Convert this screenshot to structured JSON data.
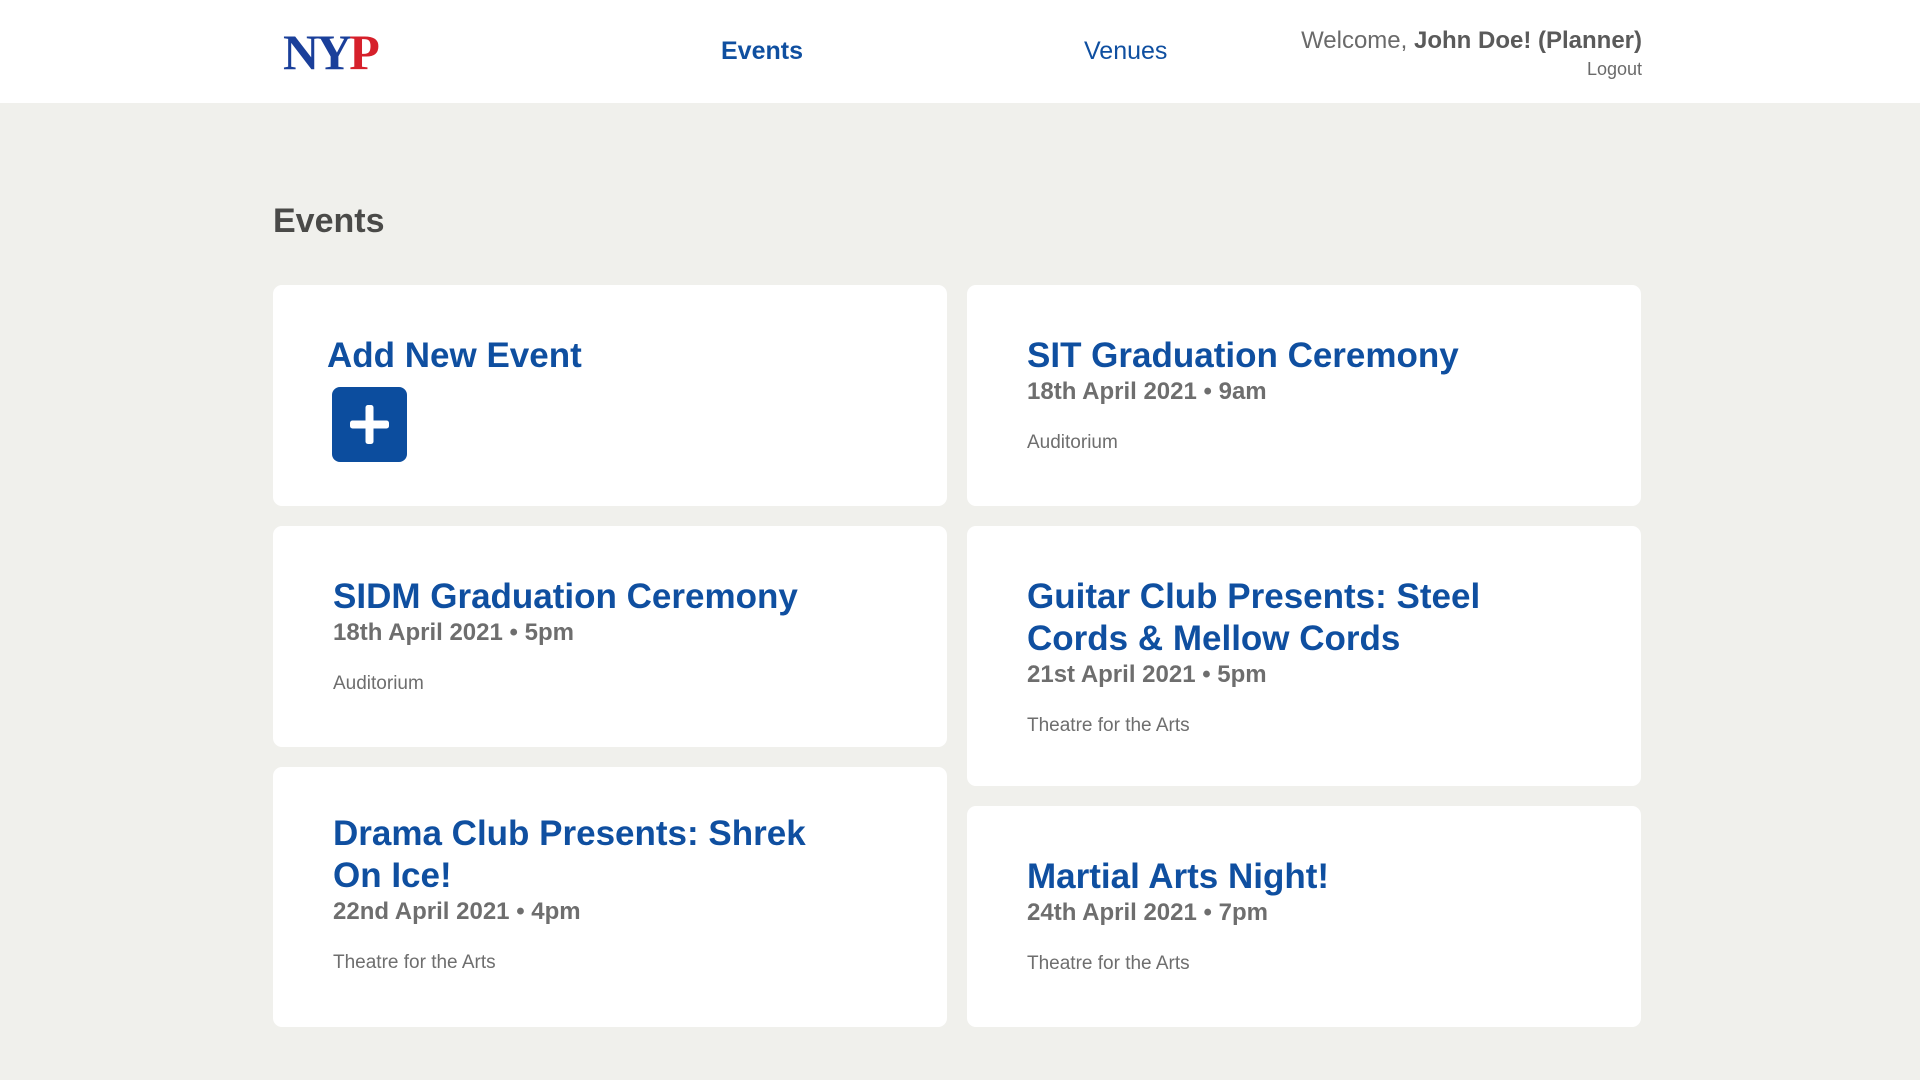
{
  "header": {
    "logo_ny": "NY",
    "logo_p": "P",
    "nav": [
      {
        "label": "Events"
      },
      {
        "label": "Venues"
      }
    ],
    "welcome_prefix": "Welcome, ",
    "user_name": "John Doe! (Planner)",
    "logout_label": "Logout"
  },
  "main": {
    "title": "Events",
    "add_card": {
      "label": "Add New Event"
    },
    "events": [
      {
        "title": "SIT Graduation Ceremony",
        "when": "18th April 2021 • 9am",
        "venue": "Auditorium"
      },
      {
        "title": "SIDM Graduation Ceremony",
        "when": "18th April 2021 • 5pm",
        "venue": "Auditorium"
      },
      {
        "title": "Guitar Club Presents: Steel Cords & Mellow Cords",
        "when": "21st April 2021 • 5pm",
        "venue": "Theatre for the Arts"
      },
      {
        "title": "Drama Club Presents: Shrek On Ice!",
        "when": "22nd April 2021 • 4pm",
        "venue": "Theatre for the Arts"
      },
      {
        "title": "Martial Arts Night!",
        "when": "24th April 2021 • 7pm",
        "venue": "Theatre for the Arts"
      }
    ]
  },
  "icons": {
    "add": "plus-icon"
  },
  "colors": {
    "accent": "#0f4fa0",
    "logo_blue": "#1a3f9a",
    "logo_red": "#d6202b",
    "background": "#f0f0ec",
    "card": "#ffffff",
    "muted_text": "#6e6e6e"
  }
}
